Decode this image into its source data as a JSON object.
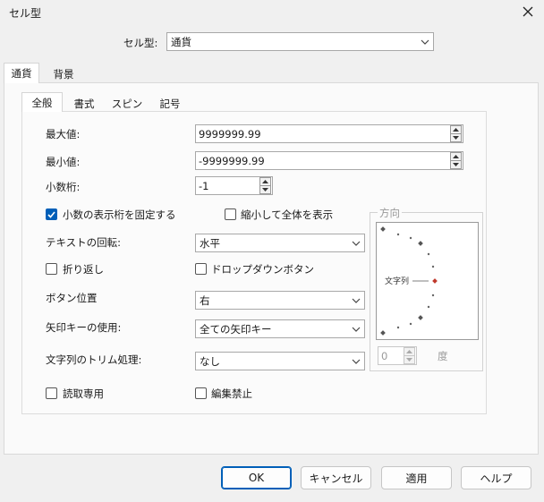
{
  "window": {
    "title": "セル型",
    "close_icon": "close-icon"
  },
  "cell_type": {
    "label": "セル型:",
    "value": "通貨"
  },
  "outer_tabs": [
    {
      "label": "通貨"
    },
    {
      "label": "背景"
    }
  ],
  "inner_tabs": [
    {
      "label": "全般"
    },
    {
      "label": "書式"
    },
    {
      "label": "スピン"
    },
    {
      "label": "記号"
    }
  ],
  "fields": {
    "max": {
      "label": "最大値:",
      "value": "9999999.99"
    },
    "min": {
      "label": "最小値:",
      "value": "-9999999.99"
    },
    "decimals": {
      "label": "小数桁:",
      "value": "-1"
    }
  },
  "checkboxes": {
    "fixed_decimals": {
      "label": "小数の表示桁を固定する",
      "checked": true
    },
    "shrink_to_fit": {
      "label": "縮小して全体を表示",
      "checked": false
    },
    "wrap": {
      "label": "折り返し",
      "checked": false
    },
    "dropdown_button": {
      "label": "ドロップダウンボタン",
      "checked": false
    },
    "read_only": {
      "label": "読取専用",
      "checked": false
    },
    "edit_lock": {
      "label": "編集禁止",
      "checked": false
    }
  },
  "selects": {
    "text_rotation": {
      "label": "テキストの回転:",
      "value": "水平"
    },
    "button_position": {
      "label": "ボタン位置",
      "value": "右"
    },
    "arrow_keys": {
      "label": "矢印キーの使用:",
      "value": "全ての矢印キー"
    },
    "trim": {
      "label": "文字列のトリム処理:",
      "value": "なし"
    }
  },
  "orientation": {
    "title": "方向",
    "dial_text": "文字列",
    "degree_value": "0",
    "degree_unit": "度",
    "accent_color": "#c0392b"
  },
  "buttons": {
    "ok": "OK",
    "cancel": "キャンセル",
    "apply": "適用",
    "help": "ヘルプ"
  }
}
